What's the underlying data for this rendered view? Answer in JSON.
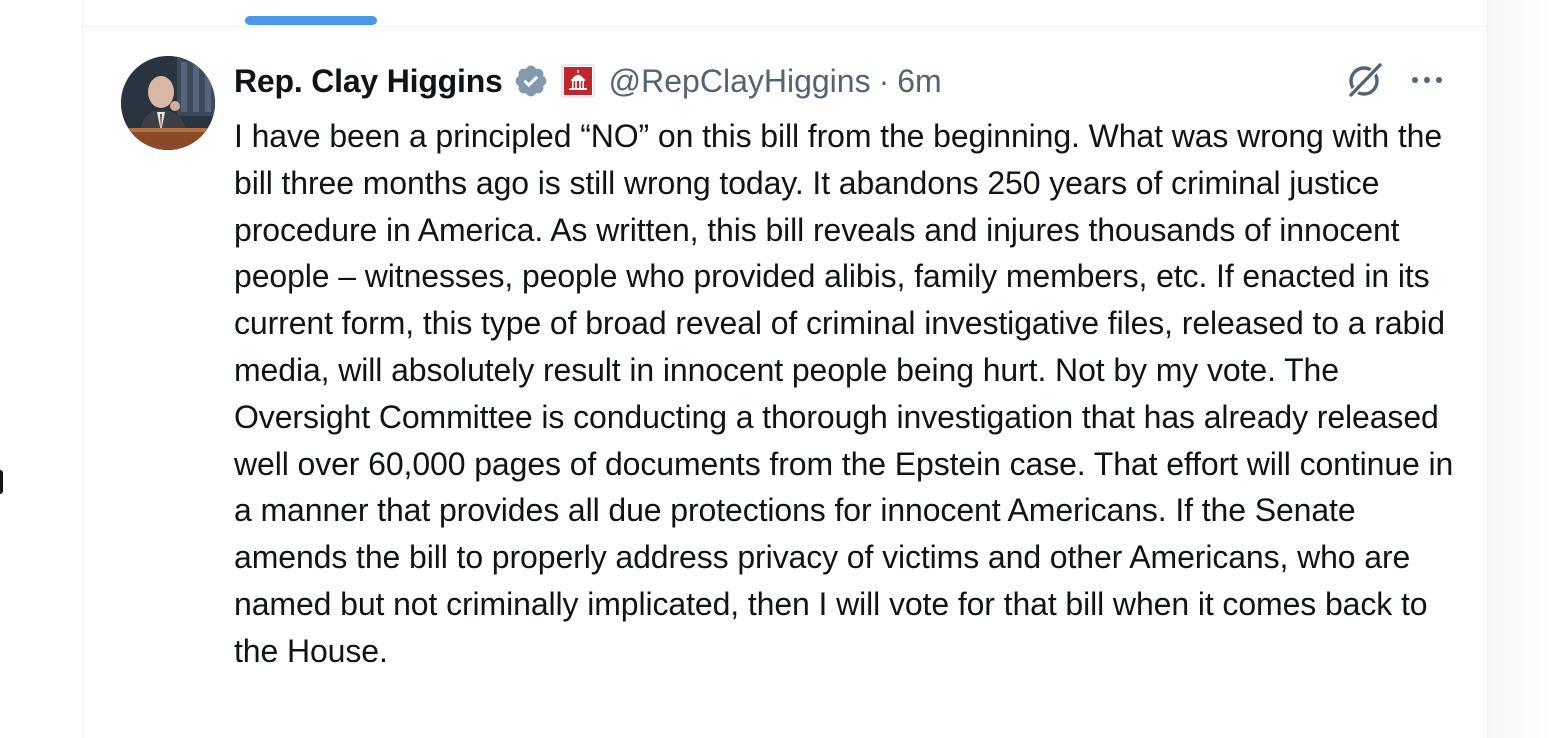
{
  "post": {
    "author": {
      "display_name": "Rep. Clay Higgins",
      "handle": "@RepClayHiggins",
      "verified_badge": "verified-badge-icon",
      "affiliation_badge": "us-capitol-badge-icon"
    },
    "separator": "·",
    "time": "6m",
    "text": "I have been a principled “NO” on this bill from the beginning. What was wrong with the bill three months ago is still wrong today. It abandons 250 years of criminal justice procedure in America. As written, this bill reveals and injures thousands of innocent people – witnesses, people who provided alibis, family members, etc. If enacted in its current form, this type of broad reveal of criminal investigative files, released to a rabid media, will absolutely result in innocent people being hurt. Not by my vote. The Oversight Committee is conducting a thorough investigation that has already released well over 60,000 pages of documents from the Epstein case. That effort will continue in a manner that provides all due protections for innocent Americans. If the Senate amends the bill to properly address privacy of victims and other Americans, who are named but not criminally implicated, then I will vote for that bill when it comes back to the House."
  },
  "icons": {
    "grok": "grok-icon",
    "more": "more-options-icon"
  },
  "colors": {
    "tab_indicator": "#4a99e9",
    "verified_badge": "#829aab",
    "affiliation_badge": "#c0272d",
    "secondary_text": "#536471",
    "primary_text": "#0f1419"
  }
}
